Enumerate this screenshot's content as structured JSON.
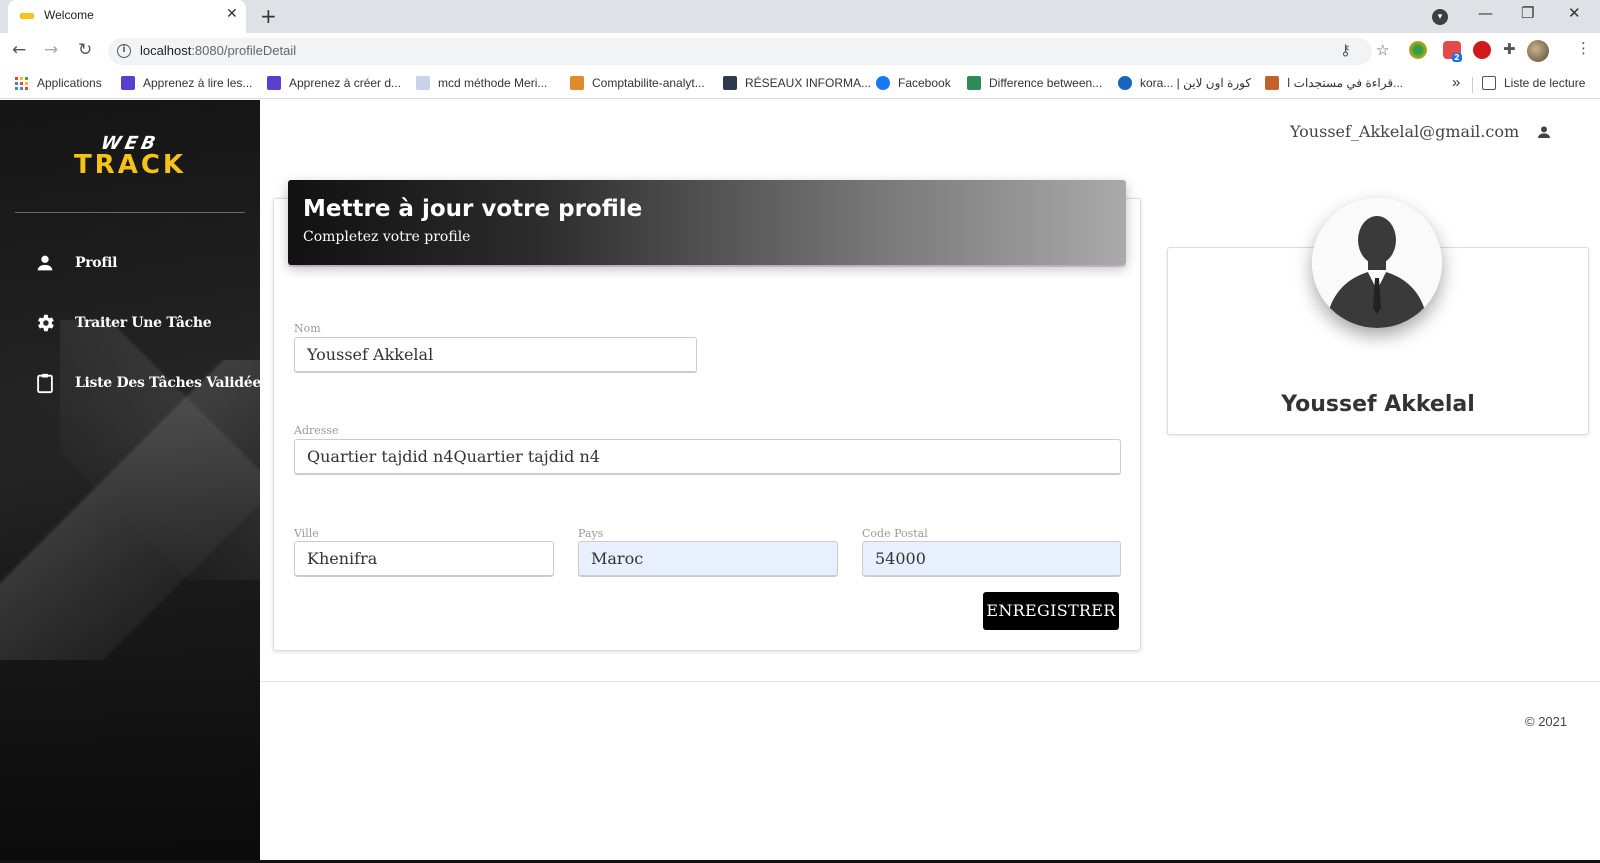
{
  "browser": {
    "tab_title": "Welcome",
    "tab_close": "✕",
    "new_tab": "+",
    "url_host": "localhost",
    "url_path": ":8080/profileDetail",
    "ext_badge": "2",
    "bookmarks": [
      {
        "label": "Applications",
        "icon": "apps-grid-icon"
      },
      {
        "label": "Apprenez à lire les...",
        "icon": "bookmark-icon",
        "color": "#5a3fd0"
      },
      {
        "label": "Apprenez à créer d...",
        "icon": "bookmark-icon",
        "color": "#5a3fd0"
      },
      {
        "label": "mcd méthode Meri...",
        "icon": "bookmark-icon",
        "color": "#c7d3e8"
      },
      {
        "label": "Comptabilite-analyt...",
        "icon": "bookmark-icon",
        "color": "#e08a2e"
      },
      {
        "label": "RÉSEAUX INFORMA...",
        "icon": "bookmark-icon",
        "color": "#2f3a4f"
      },
      {
        "label": "Facebook",
        "icon": "facebook-icon",
        "color": "#1877f2"
      },
      {
        "label": "Difference between...",
        "icon": "bookmark-icon",
        "color": "#2e8b57"
      },
      {
        "label": "kora... | كورة اون لاين",
        "icon": "bookmark-icon",
        "color": "#1565c0"
      },
      {
        "label": "قراءة في مستجدات ا...",
        "icon": "bookmark-icon",
        "color": "#c0622a"
      }
    ],
    "more_bookmarks": "»",
    "reading_list": "Liste de lecture"
  },
  "sidebar": {
    "logo_top": "WEB",
    "logo_main": "TRACK",
    "items": [
      {
        "label": "Profil",
        "icon": "person-icon"
      },
      {
        "label": "Traiter Une Tâche",
        "icon": "gear-icon"
      },
      {
        "label": "Liste Des Tâches Validées",
        "icon": "clipboard-icon"
      }
    ]
  },
  "header": {
    "email": "Youssef_Akkelal@gmail.com"
  },
  "form": {
    "title": "Mettre à jour votre profile",
    "subtitle": "Completez votre profile",
    "nom_label": "Nom",
    "nom_value": "Youssef Akkelal",
    "adresse_label": "Adresse",
    "adresse_value": "Quartier tajdid n4Quartier tajdid n4",
    "ville_label": "Ville",
    "ville_value": "Khenifra",
    "pays_label": "Pays",
    "pays_value": "Maroc",
    "code_postal_label": "Code Postal",
    "code_postal_value": "54000",
    "save_label": "ENREGISTRER"
  },
  "profile": {
    "name": "Youssef Akkelal"
  },
  "footer": {
    "copyright": "© 2021"
  },
  "colors": {
    "accent": "#000000",
    "logo_yellow": "#f5c21a",
    "autofill_bg": "#e8f0fe"
  }
}
